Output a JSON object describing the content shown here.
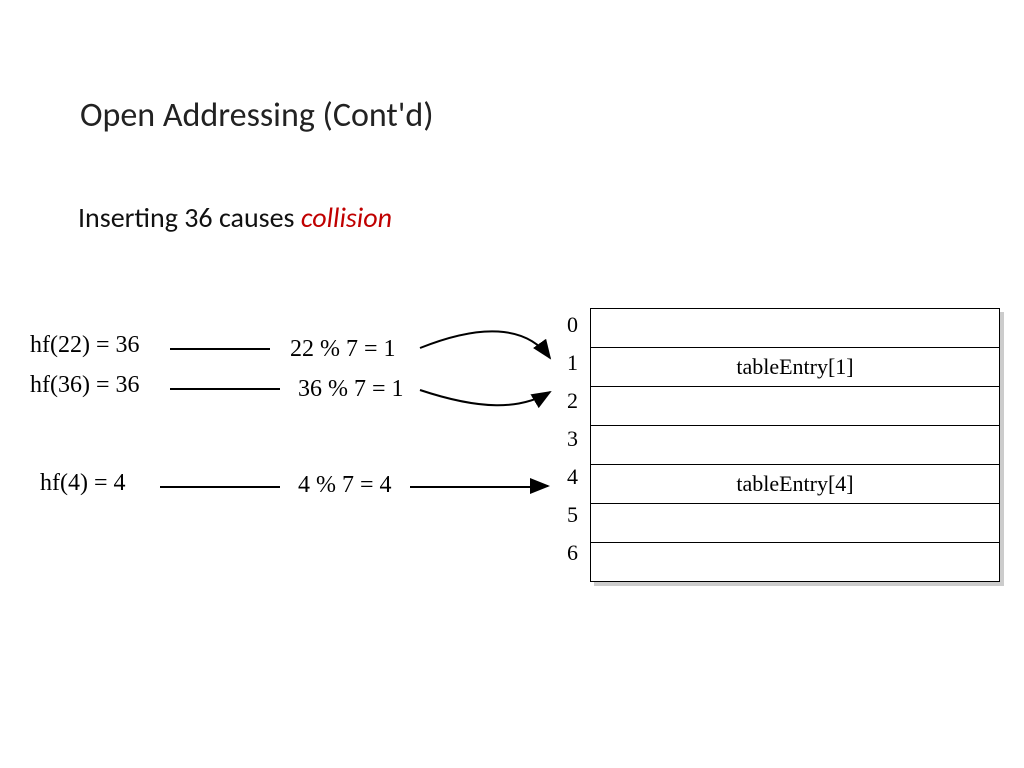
{
  "title": "Open Addressing (Cont'd)",
  "subtitle_text": "Inserting 36 causes ",
  "subtitle_highlight": "collision",
  "hash_fns": [
    {
      "label": "hf(22) = 36",
      "mod": "22 % 7 = 1"
    },
    {
      "label": "hf(36) = 36",
      "mod": "36 % 7 = 1"
    },
    {
      "label": "hf(4) = 4",
      "mod": "4 % 7 = 4"
    }
  ],
  "indices": [
    "0",
    "1",
    "2",
    "3",
    "4",
    "5",
    "6"
  ],
  "table_entries": [
    "",
    "tableEntry[1]",
    "",
    "",
    "tableEntry[4]",
    "",
    ""
  ]
}
